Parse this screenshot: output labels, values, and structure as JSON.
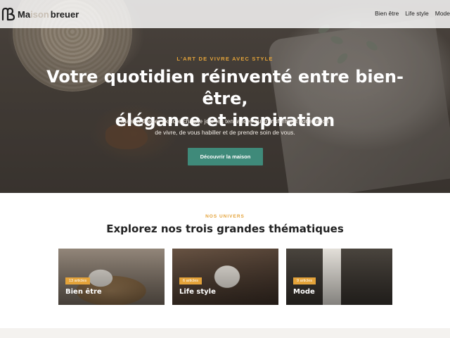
{
  "brand": {
    "logo_mark": "mb-monogram-icon",
    "name_start": "Ma",
    "name_faded": "ison",
    "name_end": "breuer"
  },
  "nav": {
    "items": [
      {
        "label": "Bien être"
      },
      {
        "label": "Life style"
      },
      {
        "label": "Mode"
      }
    ]
  },
  "hero": {
    "eyebrow": "L'ART DE VIVRE AVEC STYLE",
    "title_line1": "Votre quotidien réinventé entre bien-être,",
    "title_line2": "élégance et inspiration",
    "subtitle_line1": "Maison Breuer explore chaque jour les tendances qui transforment votre façon",
    "subtitle_line2": "de vivre, de vous habiller et de prendre soin de vous.",
    "cta_label": "Découvrir la maison"
  },
  "universes": {
    "eyebrow": "NOS UNIVERS",
    "title": "Explorez nos trois grandes thématiques",
    "cards": [
      {
        "badge": "13 articles",
        "title": "Bien être"
      },
      {
        "badge": "6 articles",
        "title": "Life style"
      },
      {
        "badge": "9 articles",
        "title": "Mode"
      }
    ]
  },
  "colors": {
    "accent": "#e4a33a",
    "cta": "#3f8a7a"
  }
}
